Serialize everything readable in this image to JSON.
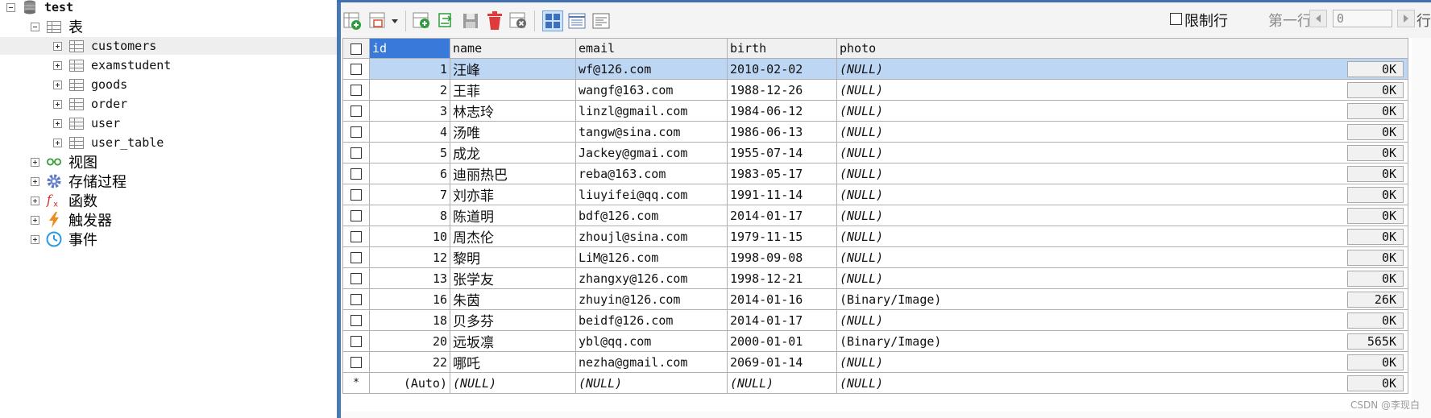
{
  "tree": {
    "db_name": "test",
    "tables_label": "表",
    "tables": [
      "customers",
      "examstudent",
      "goods",
      "order",
      "user",
      "user_table"
    ],
    "selected_table": "customers",
    "other_nodes": [
      {
        "label": "视图",
        "icon": "view-icon"
      },
      {
        "label": "存储过程",
        "icon": "gear-icon"
      },
      {
        "label": "函数",
        "icon": "function-icon"
      },
      {
        "label": "触发器",
        "icon": "lightning-icon"
      },
      {
        "label": "事件",
        "icon": "clock-icon"
      }
    ]
  },
  "toolbar": {
    "limit_label": "限制行",
    "first_row_label": "第一行:",
    "first_row_value": "0",
    "cutoff_text": "行"
  },
  "grid": {
    "columns": [
      "id",
      "name",
      "email",
      "birth",
      "photo"
    ],
    "rows": [
      {
        "id": "1",
        "name": "汪峰",
        "email": "wf@126.com",
        "birth": "2010-02-02",
        "photo": "(NULL)",
        "size": "0K"
      },
      {
        "id": "2",
        "name": "王菲",
        "email": "wangf@163.com",
        "birth": "1988-12-26",
        "photo": "(NULL)",
        "size": "0K"
      },
      {
        "id": "3",
        "name": "林志玲",
        "email": "linzl@gmail.com",
        "birth": "1984-06-12",
        "photo": "(NULL)",
        "size": "0K"
      },
      {
        "id": "4",
        "name": "汤唯",
        "email": "tangw@sina.com",
        "birth": "1986-06-13",
        "photo": "(NULL)",
        "size": "0K"
      },
      {
        "id": "5",
        "name": "成龙",
        "email": "Jackey@gmai.com",
        "birth": "1955-07-14",
        "photo": "(NULL)",
        "size": "0K"
      },
      {
        "id": "6",
        "name": "迪丽热巴",
        "email": "reba@163.com",
        "birth": "1983-05-17",
        "photo": "(NULL)",
        "size": "0K"
      },
      {
        "id": "7",
        "name": "刘亦菲",
        "email": "liuyifei@qq.com",
        "birth": "1991-11-14",
        "photo": "(NULL)",
        "size": "0K"
      },
      {
        "id": "8",
        "name": "陈道明",
        "email": "bdf@126.com",
        "birth": "2014-01-17",
        "photo": "(NULL)",
        "size": "0K"
      },
      {
        "id": "10",
        "name": "周杰伦",
        "email": "zhoujl@sina.com",
        "birth": "1979-11-15",
        "photo": "(NULL)",
        "size": "0K"
      },
      {
        "id": "12",
        "name": "黎明",
        "email": "LiM@126.com",
        "birth": "1998-09-08",
        "photo": "(NULL)",
        "size": "0K"
      },
      {
        "id": "13",
        "name": "张学友",
        "email": "zhangxy@126.com",
        "birth": "1998-12-21",
        "photo": "(NULL)",
        "size": "0K"
      },
      {
        "id": "16",
        "name": "朱茵",
        "email": "zhuyin@126.com",
        "birth": "2014-01-16",
        "photo": "(Binary/Image)",
        "size": "26K"
      },
      {
        "id": "18",
        "name": "贝多芬",
        "email": "beidf@126.com",
        "birth": "2014-01-17",
        "photo": "(NULL)",
        "size": "0K"
      },
      {
        "id": "20",
        "name": "远坂凛",
        "email": "ybl@qq.com",
        "birth": "2000-01-01",
        "photo": "(Binary/Image)",
        "size": "565K"
      },
      {
        "id": "22",
        "name": "哪吒",
        "email": "nezha@gmail.com",
        "birth": "2069-01-14",
        "photo": "(NULL)",
        "size": "0K"
      }
    ],
    "new_row": {
      "marker": "*",
      "id": "(Auto)",
      "name": "(NULL)",
      "email": "(NULL)",
      "birth": "(NULL)",
      "photo": "(NULL)",
      "size": "0K"
    }
  },
  "watermark": "CSDN @李现白",
  "colors": {
    "selection": "#bcd6f3",
    "header_selected": "#3879d9",
    "panel_border": "#4a78b5"
  }
}
